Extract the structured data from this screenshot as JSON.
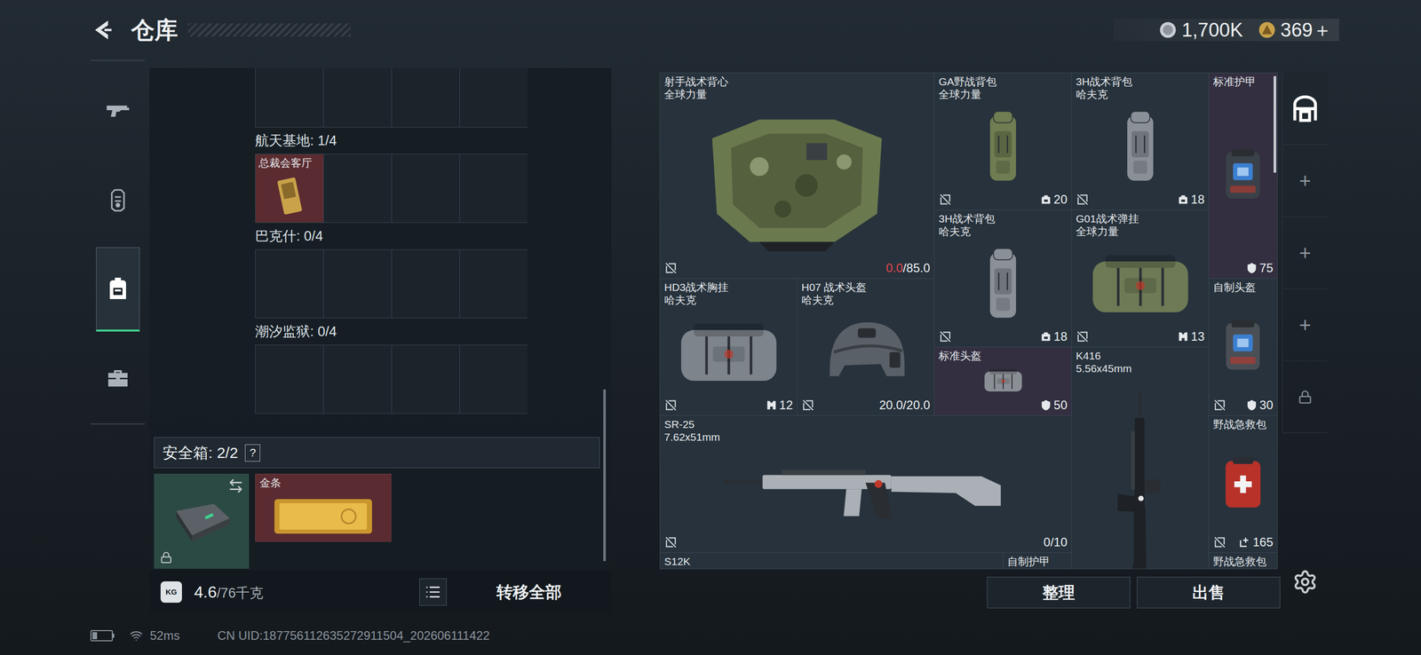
{
  "header": {
    "title": "仓库"
  },
  "currencies": [
    {
      "value": "1,700K",
      "kind": "coin"
    },
    {
      "value": "369＋",
      "kind": "token"
    }
  ],
  "nav": [
    {
      "selected": false
    },
    {
      "selected": false
    },
    {
      "selected": true
    },
    {
      "selected": false
    }
  ],
  "keys": {
    "partial_row": [
      {
        "filled": false
      },
      {
        "filled": false
      },
      {
        "filled": false
      },
      {
        "filled": false
      }
    ],
    "sections": [
      {
        "label": "航天基地: 1/4",
        "slots": [
          {
            "filled": true,
            "name": "总裁会客厅",
            "color": "#5a2b30"
          },
          {
            "filled": false
          },
          {
            "filled": false
          },
          {
            "filled": false
          }
        ]
      },
      {
        "label": "巴克什: 0/4",
        "slots": [
          {
            "filled": false
          },
          {
            "filled": false
          },
          {
            "filled": false
          },
          {
            "filled": false
          }
        ]
      },
      {
        "label": "潮汐监狱: 0/4",
        "slots": [
          {
            "filled": false
          },
          {
            "filled": false
          },
          {
            "filled": false
          },
          {
            "filled": false
          }
        ]
      }
    ]
  },
  "safebox": {
    "label": "安全箱: 2/2",
    "help": "?",
    "case": {
      "locked": true
    },
    "items": [
      {
        "name": "金条",
        "color": "#5a2b30"
      }
    ]
  },
  "footer": {
    "weight_icon": "KG",
    "weight": "4.6",
    "capacity": "/76千克",
    "transfer": "转移全部"
  },
  "stash": [
    {
      "name": "射手战术背心",
      "sub": "全球力量",
      "kind": "vest",
      "tint": "#6b7a4e",
      "color": "#27323c",
      "marked": true,
      "stat": {
        "kind": "durability",
        "current": "0.0",
        "max": "/85.0",
        "low": true
      }
    },
    {
      "name": "GA野战背包",
      "sub": "全球力量",
      "kind": "backpack",
      "tint": "#6f7d52",
      "color": "#27323c",
      "marked": true,
      "stat": {
        "kind": "capacity",
        "value": "20"
      }
    },
    {
      "name": "3H战术背包",
      "sub": "哈夫克",
      "kind": "backpack",
      "tint": "#8a9098",
      "color": "#27323c",
      "marked": true,
      "stat": {
        "kind": "capacity",
        "value": "18"
      }
    },
    {
      "name": "标准护甲",
      "kind": "armor",
      "tint": "#3b4148",
      "color": "#332f40",
      "marked": false,
      "stat": {
        "kind": "armor",
        "value": "75"
      }
    },
    {
      "name": "3H战术背包",
      "sub": "哈夫克",
      "kind": "backpack",
      "tint": "#8a9098",
      "color": "#27323c",
      "marked": true,
      "stat": {
        "kind": "capacity",
        "value": "18"
      }
    },
    {
      "name": "G01战术弹挂",
      "sub": "全球力量",
      "kind": "bag",
      "tint": "#6d7a55",
      "color": "#27323c",
      "marked": true,
      "stat": {
        "kind": "rig",
        "value": "13"
      }
    },
    {
      "name": "HD3战术胸挂",
      "sub": "哈夫克",
      "kind": "bag",
      "tint": "#7d848c",
      "color": "#27323c",
      "marked": true,
      "stat": {
        "kind": "rig",
        "value": "12"
      }
    },
    {
      "name": "H07 战术头盔",
      "sub": "哈夫克",
      "kind": "helmet",
      "tint": "#5a6068",
      "color": "#27323c",
      "marked": true,
      "stat": {
        "kind": "durability",
        "current": "20.0",
        "max": "/20.0",
        "low": false
      }
    },
    {
      "name": "标准头盔",
      "kind": "bag",
      "tint": "#8a8f95",
      "color": "#332f40",
      "marked": false,
      "stat": {
        "kind": "armor",
        "value": "50"
      }
    },
    {
      "name": "K416",
      "sub": "5.56x45mm",
      "kind": "rifle-vertical",
      "tint": "#1e2226",
      "color": "#27323c",
      "marked": false
    },
    {
      "name": "自制头盔",
      "kind": "armor",
      "tint": "#4a4f55",
      "color": "#27323c",
      "marked": true,
      "stat": {
        "kind": "armor",
        "value": "30"
      }
    },
    {
      "name": "SR-25",
      "sub": "7.62x51mm",
      "kind": "rifle",
      "tint": "#aab0b6",
      "color": "#27323c",
      "marked": true,
      "stat": {
        "kind": "ammo",
        "value": "0/10"
      }
    },
    {
      "name": "野战急救包",
      "kind": "medkit",
      "tint": "#b8322a",
      "color": "#27323c",
      "marked": true,
      "stat": {
        "kind": "heal",
        "value": "165"
      }
    },
    {
      "name": "S12K",
      "kind": "rifle",
      "tint": "#2a2e33",
      "color": "#27323c",
      "marked": false
    },
    {
      "name": "自制护甲",
      "kind": "armor",
      "tint": "#4a4f55",
      "color": "#27323c",
      "marked": false
    },
    {
      "name": "野战急救包",
      "kind": "medkit",
      "tint": "#b8322a",
      "color": "#27323c",
      "marked": false
    }
  ],
  "strip": [
    {
      "kind": "stash",
      "selected": true
    },
    {
      "kind": "add",
      "label": "+",
      "selected": false
    },
    {
      "kind": "add",
      "label": "+",
      "selected": false
    },
    {
      "kind": "add",
      "label": "+",
      "selected": false
    },
    {
      "kind": "locked",
      "selected": false
    }
  ],
  "buttons": [
    "整理",
    "出售"
  ],
  "status": {
    "battery": 0.25,
    "ping": "52ms",
    "uid": "CN UID:187756112635272911504_202606111422"
  }
}
